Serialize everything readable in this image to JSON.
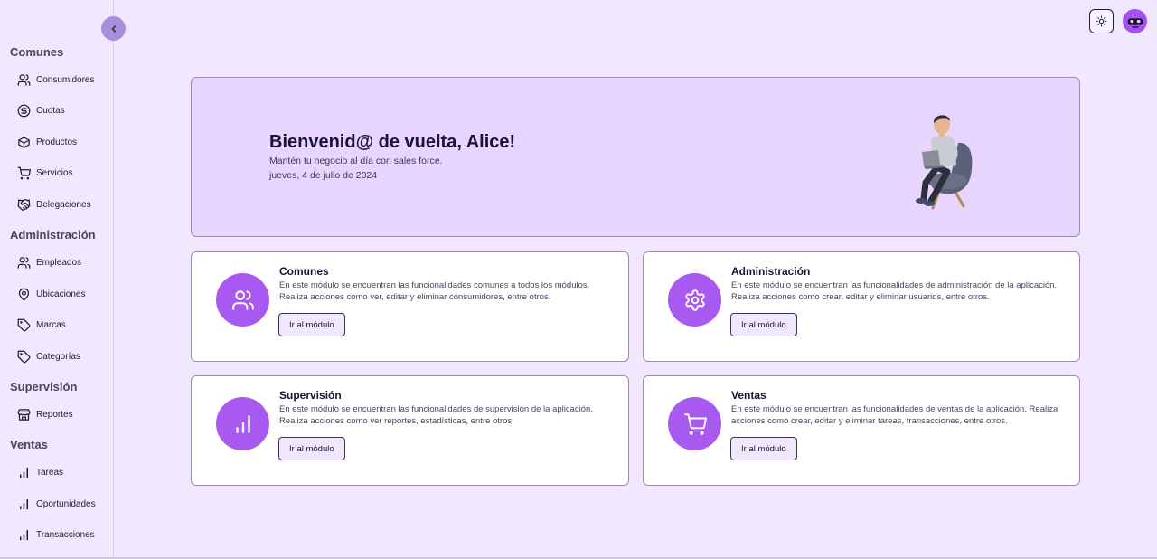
{
  "sidebar": {
    "sections": [
      {
        "title": "Comunes",
        "items": [
          {
            "label": "Consumidores",
            "icon": "users-icon"
          },
          {
            "label": "Cuotas",
            "icon": "dollar-circle-icon"
          },
          {
            "label": "Productos",
            "icon": "box-icon"
          },
          {
            "label": "Servicios",
            "icon": "cart-icon"
          },
          {
            "label": "Delegaciones",
            "icon": "handshake-icon"
          }
        ]
      },
      {
        "title": "Administración",
        "items": [
          {
            "label": "Empleados",
            "icon": "users-icon"
          },
          {
            "label": "Ubicaciones",
            "icon": "map-pin-icon"
          },
          {
            "label": "Marcas",
            "icon": "tag-icon"
          },
          {
            "label": "Categorías",
            "icon": "tag-icon"
          }
        ]
      },
      {
        "title": "Supervisión",
        "items": [
          {
            "label": "Reportes",
            "icon": "store-icon"
          }
        ]
      },
      {
        "title": "Ventas",
        "items": [
          {
            "label": "Tareas",
            "icon": "bar-chart-icon"
          },
          {
            "label": "Oportunidades",
            "icon": "bar-chart-icon"
          },
          {
            "label": "Transacciones",
            "icon": "bar-chart-icon"
          }
        ]
      }
    ]
  },
  "header": {
    "theme_toggle_icon": "sun-icon",
    "avatar_icon": "robot-avatar-icon"
  },
  "hero": {
    "title": "Bienvenid@ de vuelta, Alice!",
    "subtitle": "Mantén tu negocio al día con sales force.",
    "date": "jueves, 4 de julio de 2024"
  },
  "modules": [
    {
      "title": "Comunes",
      "description": "En este módulo se encuentran las funcionalidades comunes a todos los módulos. Realiza acciones como ver, editar y eliminar consumidores, entre otros.",
      "button": "Ir al módulo",
      "icon": "users-icon"
    },
    {
      "title": "Administración",
      "description": "En este módulo se encuentran las funcionalidades de administración de la aplicación. Realiza acciones como crear, editar y eliminar usuarios, entre otros.",
      "button": "Ir al módulo",
      "icon": "gear-icon"
    },
    {
      "title": "Supervisión",
      "description": "En este módulo se encuentran las funcionalidades de supervisión de la aplicación. Realiza acciones como ver reportes, estadísticas, entre otros.",
      "button": "Ir al módulo",
      "icon": "bar-chart-icon"
    },
    {
      "title": "Ventas",
      "description": "En este módulo se encuentran las funcionalidades de ventas de la aplicación. Realiza acciones como crear, editar y eliminar tareas, transacciones, entre otros.",
      "button": "Ir al módulo",
      "icon": "cart-icon"
    }
  ],
  "colors": {
    "background": "#f1e8fe",
    "hero_background": "#e7d5fd",
    "accent": "#a85af0",
    "text": "#1e1b3a"
  }
}
